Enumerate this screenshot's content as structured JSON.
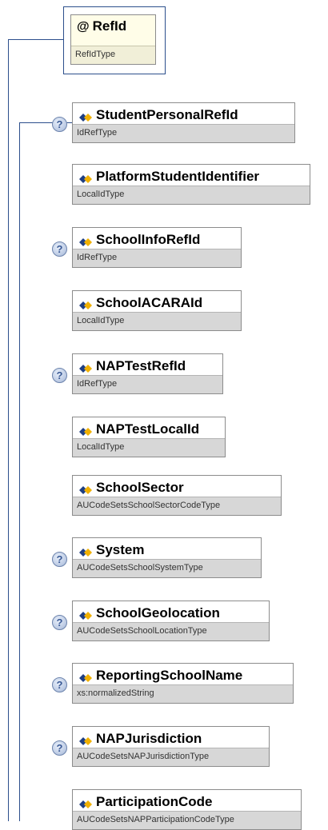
{
  "root": {
    "symbol": "@",
    "name": "RefId",
    "type": "RefIdType"
  },
  "optional_marker": "?",
  "elements": [
    {
      "name": "StudentPersonalRefId",
      "type": "IdRefType",
      "optional": true
    },
    {
      "name": "PlatformStudentIdentifier",
      "type": "LocalIdType",
      "optional": false
    },
    {
      "name": "SchoolInfoRefId",
      "type": "IdRefType",
      "optional": true
    },
    {
      "name": "SchoolACARAId",
      "type": "LocalIdType",
      "optional": false
    },
    {
      "name": "NAPTestRefId",
      "type": "IdRefType",
      "optional": true
    },
    {
      "name": "NAPTestLocalId",
      "type": "LocalIdType",
      "optional": false
    },
    {
      "name": "SchoolSector",
      "type": "AUCodeSetsSchoolSectorCodeType",
      "optional": false
    },
    {
      "name": "System",
      "type": "AUCodeSetsSchoolSystemType",
      "optional": true
    },
    {
      "name": "SchoolGeolocation",
      "type": "AUCodeSetsSchoolLocationType",
      "optional": true
    },
    {
      "name": "ReportingSchoolName",
      "type": "xs:normalizedString",
      "optional": true
    },
    {
      "name": "NAPJurisdiction",
      "type": "AUCodeSetsNAPJurisdictionType",
      "optional": true
    },
    {
      "name": "ParticipationCode",
      "type": "AUCodeSetsNAPParticipationCodeType",
      "optional": false
    }
  ]
}
